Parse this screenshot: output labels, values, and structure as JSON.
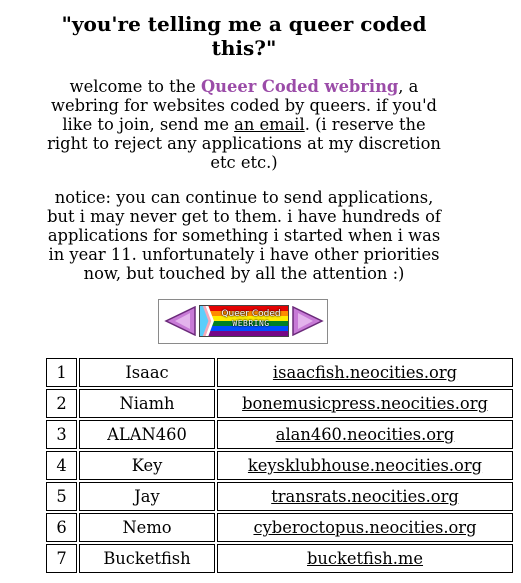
{
  "title": "\"you're telling me a queer coded this?\"",
  "intro": {
    "before": "welcome to the ",
    "brand": "Queer Coded webring",
    "middle": ", a webring for websites coded by queers. if you'd like to join, send me ",
    "email_link": "an email",
    "after": ". (i reserve the right to reject any applications at my discretion etc etc.)"
  },
  "notice": "notice: you can continue to send applications, but i may never get to them. i have hundreds of applications for something i started when i was in year 11. unfortunately i have other priorities now, but touched by all the attention :)",
  "webring": {
    "banner_line1": "Queer Coded",
    "banner_line2": "WEBRING",
    "prev_icon": "left-arrow-icon",
    "next_icon": "right-arrow-icon"
  },
  "colors": {
    "brand": "#9b4ca8",
    "arrow": "#c77ad6"
  },
  "members": [
    {
      "num": "1",
      "name": "Isaac",
      "url": "isaacfish.neocities.org"
    },
    {
      "num": "2",
      "name": "Niamh",
      "url": "bonemusicpress.neocities.org"
    },
    {
      "num": "3",
      "name": "ALAN460",
      "url": "alan460.neocities.org"
    },
    {
      "num": "4",
      "name": "Key",
      "url": "keysklubhouse.neocities.org"
    },
    {
      "num": "5",
      "name": "Jay",
      "url": "transrats.neocities.org"
    },
    {
      "num": "6",
      "name": "Nemo",
      "url": "cyberoctopus.neocities.org"
    },
    {
      "num": "7",
      "name": "Bucketfish",
      "url": "bucketfish.me"
    }
  ]
}
